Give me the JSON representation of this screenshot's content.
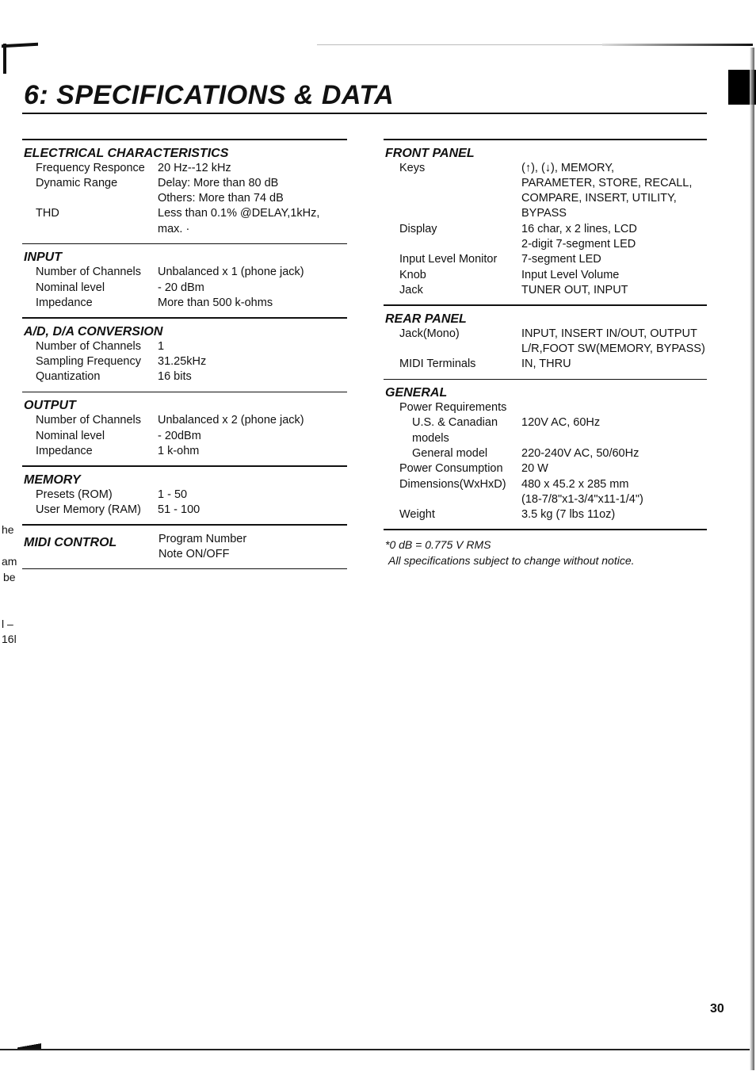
{
  "page": {
    "title": "6: SPECIFICATIONS & DATA",
    "page_number": "30",
    "margin_fragments": [
      "he",
      "am",
      "be",
      "l –",
      "16l"
    ]
  },
  "left_column": {
    "sections": [
      {
        "title": "ELECTRICAL CHARACTERISTICS",
        "rows": [
          {
            "label": "Frequency Responce",
            "value": "20 Hz--12 kHz"
          },
          {
            "label": "Dynamic Range",
            "value": "Delay: More than 80 dB"
          },
          {
            "label": "",
            "value": "Others: More than 74 dB"
          },
          {
            "label": "THD",
            "value": "Less than 0.1% @DELAY,1kHz, max. ·"
          }
        ]
      },
      {
        "title": "INPUT",
        "rows": [
          {
            "label": "Number of Channels",
            "value": "Unbalanced x 1 (phone jack)"
          },
          {
            "label": "Nominal level",
            "value": "- 20 dBm"
          },
          {
            "label": "Impedance",
            "value": "More than 500 k-ohms"
          }
        ]
      },
      {
        "title": "A/D, D/A CONVERSION",
        "rows": [
          {
            "label": "Number of Channels",
            "value": "1"
          },
          {
            "label": "Sampling Frequency",
            "value": "31.25kHz"
          },
          {
            "label": "Quantization",
            "value": "16 bits"
          }
        ]
      },
      {
        "title": "OUTPUT",
        "rows": [
          {
            "label": "Number of Channels",
            "value": "Unbalanced x 2 (phone jack)"
          },
          {
            "label": "Nominal level",
            "value": "- 20dBm"
          },
          {
            "label": "Impedance",
            "value": "1 k-ohm"
          }
        ]
      },
      {
        "title": "MEMORY",
        "rows": [
          {
            "label": "Presets (ROM)",
            "value": "1 - 50"
          },
          {
            "label": "User Memory (RAM)",
            "value": "51 - 100"
          }
        ]
      }
    ],
    "midi_control": {
      "title": "MIDI CONTROL",
      "values": [
        "Program Number",
        "Note ON/OFF"
      ]
    }
  },
  "right_column": {
    "sections": [
      {
        "title": "FRONT PANEL",
        "rows": [
          {
            "label": "Keys",
            "value": "(↑), (↓), MEMORY,"
          },
          {
            "label": "",
            "value": "PARAMETER, STORE, RECALL,"
          },
          {
            "label": "",
            "value": "COMPARE, INSERT, UTILITY,"
          },
          {
            "label": "",
            "value": "BYPASS"
          },
          {
            "label": "Display",
            "value": "16 char, x 2 lines, LCD"
          },
          {
            "label": "",
            "value": "2-digit 7-segment LED"
          },
          {
            "label": "Input Level Monitor",
            "value": "7-segment LED"
          },
          {
            "label": "Knob",
            "value": "Input Level Volume"
          },
          {
            "label": "Jack",
            "value": "TUNER OUT, INPUT"
          }
        ]
      },
      {
        "title": "REAR PANEL",
        "rows": [
          {
            "label": "Jack(Mono)",
            "value": "INPUT, INSERT IN/OUT, OUTPUT"
          },
          {
            "label": "",
            "value": "L/R,FOOT SW(MEMORY, BYPASS)"
          },
          {
            "label": "MIDI Terminals",
            "value": "IN, THRU"
          }
        ]
      },
      {
        "title": "GENERAL",
        "rows": [
          {
            "label": "Power Requirements",
            "value": "",
            "sub": false
          },
          {
            "label": "U.S. & Canadian models",
            "value": "120V AC, 60Hz",
            "sub": true
          },
          {
            "label": "General model",
            "value": "220-240V AC, 50/60Hz",
            "sub": true
          },
          {
            "label": "Power Consumption",
            "value": "20 W"
          },
          {
            "label": "Dimensions(WxHxD)",
            "value": "480 x 45.2 x 285 mm"
          },
          {
            "label": "",
            "value": "(18-7/8\"x1-3/4\"x11-1/4\")"
          },
          {
            "label": "Weight",
            "value": "3.5 kg (7 lbs 11oz)"
          }
        ]
      }
    ],
    "notes": [
      "*0 dB = 0.775 V RMS",
      "All specifications subject to change without notice."
    ]
  }
}
